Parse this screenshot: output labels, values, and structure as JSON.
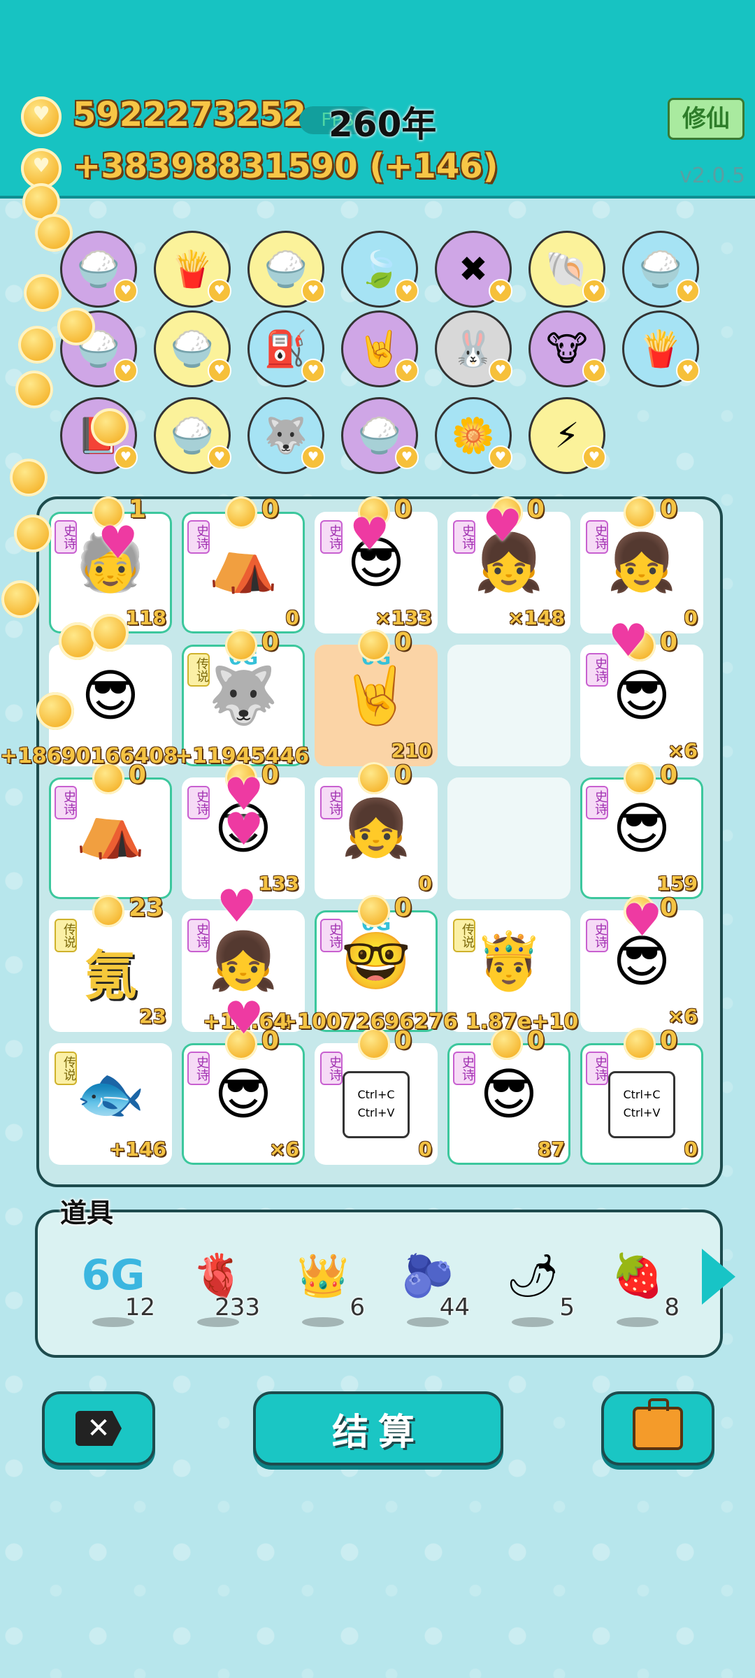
{
  "header": {
    "coins": "5922273252",
    "income": "+38398831590 (+146)",
    "fps_label": "FPS",
    "year": "260年",
    "cultivate_button": "修仙",
    "version": "v2.0.5"
  },
  "inventory": [
    {
      "icon": "rice-bowl-icon",
      "glyph": "🍚",
      "bg": "purple"
    },
    {
      "icon": "fries-icon",
      "glyph": "🍟",
      "bg": "yellow"
    },
    {
      "icon": "rice-bowl-icon",
      "glyph": "🍚",
      "bg": "yellow"
    },
    {
      "icon": "leaf-icon",
      "glyph": "🍃",
      "bg": "blue"
    },
    {
      "icon": "math-grandpa-icon",
      "glyph": "✖",
      "bg": "purple"
    },
    {
      "icon": "shell-icon",
      "glyph": "🐚",
      "bg": "yellow"
    },
    {
      "icon": "rice-bowl-icon",
      "glyph": "🍚",
      "bg": "blue"
    },
    {
      "icon": "rice-bowl-icon",
      "glyph": "🍚",
      "bg": "purple"
    },
    {
      "icon": "rice-bowl-icon",
      "glyph": "🍚",
      "bg": "yellow"
    },
    {
      "icon": "pump-icon",
      "glyph": "⛽",
      "bg": "blue"
    },
    {
      "icon": "rock-hand-icon",
      "glyph": "🤘",
      "bg": "purple"
    },
    {
      "icon": "rabbit-icon",
      "glyph": "🐰",
      "bg": "grey"
    },
    {
      "icon": "cows-icon",
      "glyph": "🐮",
      "bg": "purple"
    },
    {
      "icon": "fries-icon",
      "glyph": "🍟",
      "bg": "blue"
    },
    {
      "icon": "book-icon",
      "glyph": "📕",
      "bg": "purple"
    },
    {
      "icon": "rice-bowl-icon",
      "glyph": "🍚",
      "bg": "yellow"
    },
    {
      "icon": "husky-icon",
      "glyph": "🐺",
      "bg": "blue"
    },
    {
      "icon": "rice-bowl-icon",
      "glyph": "🍚",
      "bg": "purple"
    },
    {
      "icon": "flower-pot-icon",
      "glyph": "🌼",
      "bg": "blue"
    },
    {
      "icon": "lightning-icon",
      "glyph": "⚡",
      "bg": "yellow"
    }
  ],
  "board": {
    "tag_epic": "史诗",
    "tag_legend": "传说",
    "cells": [
      {
        "tag": "epic",
        "icon": "grandpa-green-hat-icon",
        "glyph": "🧓",
        "count": "118",
        "coin": "1",
        "style": "glow"
      },
      {
        "tag": "epic",
        "icon": "rabbit-tent-icon",
        "glyph": "⛺",
        "count": "0",
        "coin": "0",
        "style": "glow"
      },
      {
        "tag": "epic",
        "icon": "grandpa-green-hat-icon",
        "glyph": "😎",
        "count": "×133",
        "coin": "0",
        "style": ""
      },
      {
        "tag": "epic",
        "icon": "girl-braids-icon",
        "glyph": "👧",
        "count": "×148",
        "coin": "0",
        "style": ""
      },
      {
        "tag": "epic",
        "icon": "girl-braids-icon",
        "glyph": "👧",
        "count": "0",
        "coin": "0",
        "style": ""
      },
      {
        "tag": "",
        "icon": "grandpa-green-hat-icon",
        "glyph": "😎",
        "count": "",
        "coin": "",
        "style": ""
      },
      {
        "tag": "legend",
        "icon": "husky-king-icon",
        "glyph": "🐺",
        "count": "",
        "coin": "0",
        "style": "glow",
        "sixg": "6G"
      },
      {
        "tag": "",
        "icon": "rock-hand-icon",
        "glyph": "🤘",
        "count": "210",
        "coin": "0",
        "style": "orange",
        "sixg": "6G"
      },
      {
        "tag": "",
        "icon": "",
        "glyph": "",
        "count": "",
        "coin": "",
        "style": "empty"
      },
      {
        "tag": "epic",
        "icon": "grandpa-green-hat-icon",
        "glyph": "😎",
        "count": "×6",
        "coin": "0",
        "style": ""
      },
      {
        "tag": "epic",
        "icon": "rabbit-tent-icon",
        "glyph": "⛺",
        "count": "",
        "coin": "0",
        "style": "glow"
      },
      {
        "tag": "epic",
        "icon": "grandpa-green-hat-icon",
        "glyph": "😎",
        "count": "133",
        "coin": "0",
        "style": ""
      },
      {
        "tag": "epic",
        "icon": "girl-braids-icon",
        "glyph": "👧",
        "count": "0",
        "coin": "0",
        "style": ""
      },
      {
        "tag": "",
        "icon": "",
        "glyph": "",
        "count": "",
        "coin": "",
        "style": "empty"
      },
      {
        "tag": "epic",
        "icon": "grandpa-green-hat-icon",
        "glyph": "😎",
        "count": "159",
        "coin": "0",
        "style": "glow"
      },
      {
        "tag": "legend",
        "icon": "neon-char-icon",
        "glyph": "氪",
        "count": "23",
        "coin": "23",
        "style": "",
        "text": true
      },
      {
        "tag": "epic",
        "icon": "girl-braids-icon",
        "glyph": "👧",
        "count": "",
        "coin": "",
        "style": ""
      },
      {
        "tag": "epic",
        "icon": "glasses-king-icon",
        "glyph": "🤓",
        "count": "",
        "coin": "0",
        "style": "glow",
        "sixg": "6G"
      },
      {
        "tag": "legend",
        "icon": "gold-king-icon",
        "glyph": "🤴",
        "count": "",
        "coin": "",
        "style": ""
      },
      {
        "tag": "epic",
        "icon": "grandpa-green-hat-icon",
        "glyph": "😎",
        "count": "×6",
        "coin": "0",
        "style": ""
      },
      {
        "tag": "legend",
        "icon": "koi-fish-icon",
        "glyph": "🐟",
        "count": "+146",
        "coin": "",
        "style": ""
      },
      {
        "tag": "epic",
        "icon": "king-green-hat-icon",
        "glyph": "😎",
        "count": "×6",
        "coin": "0",
        "style": "glow"
      },
      {
        "tag": "epic",
        "icon": "copy-paste-icon",
        "glyph": "",
        "count": "0",
        "coin": "0",
        "style": "",
        "kbd": true
      },
      {
        "tag": "epic",
        "icon": "king-green-hat-icon",
        "glyph": "😎",
        "count": "87",
        "coin": "0",
        "style": "glow"
      },
      {
        "tag": "epic",
        "icon": "copy-paste-icon",
        "glyph": "",
        "count": "0",
        "coin": "0",
        "style": "glow",
        "kbd": true
      }
    ],
    "copy_text": "Ctrl+C",
    "paste_text": "Ctrl+V",
    "float_texts": [
      "+18690166408",
      "+11945446",
      "+10072696276",
      "1.87e+10",
      "+1...64"
    ]
  },
  "items": {
    "title": "道具",
    "list": [
      {
        "icon": "6g-icon",
        "glyph": "6G",
        "count": "12"
      },
      {
        "icon": "liver-icon",
        "glyph": "🫀",
        "count": "233"
      },
      {
        "icon": "crown-icon",
        "glyph": "👑",
        "count": "6"
      },
      {
        "icon": "blueberry-icon",
        "glyph": "🫐",
        "count": "44"
      },
      {
        "icon": "chili-icon",
        "glyph": "🌶",
        "count": "5"
      },
      {
        "icon": "strawberry-icon",
        "glyph": "🍓",
        "count": "8"
      }
    ]
  },
  "buttons": {
    "settle": "结算"
  }
}
